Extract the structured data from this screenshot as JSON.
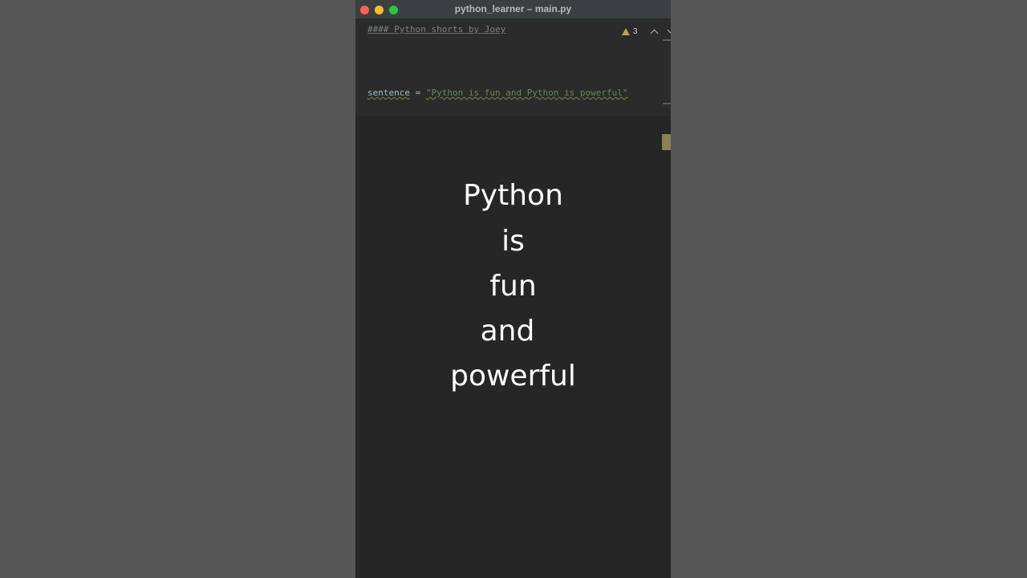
{
  "window": {
    "title": "python_learner – main.py"
  },
  "editor": {
    "comment_line": "#### Python shorts by Joey",
    "assign_var": "sentence",
    "assign_op": " = ",
    "assign_value": "\"Python is fun and Python is powerful\""
  },
  "inspection": {
    "warning_count": "3",
    "icon": "warning-icon"
  },
  "overlay": {
    "words": [
      "Python",
      "is",
      "fun",
      "and",
      "powerful"
    ]
  },
  "colors": {
    "string": "#6a8759",
    "identifier": "#a9b7c6",
    "comment": "#808080",
    "warning": "#b8a55a"
  }
}
